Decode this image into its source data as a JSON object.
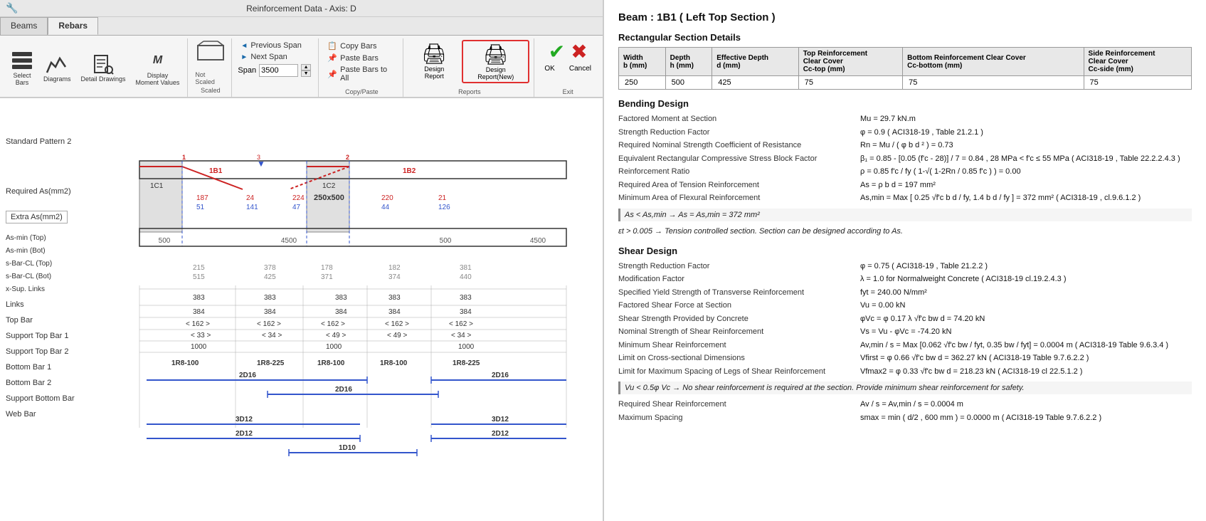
{
  "window": {
    "title": "Reinforcement Data - Axis: D"
  },
  "tabs": [
    {
      "id": "beams",
      "label": "Beams",
      "active": false
    },
    {
      "id": "rebars",
      "label": "Rebars",
      "active": true
    }
  ],
  "ribbon": {
    "select_bars_label": "Select\nBars",
    "diagrams_label": "Diagrams",
    "detail_drawings_label": "Detail\nDrawings",
    "display_moment_label": "Display\nMoment Values",
    "display_moment_abbr": "M",
    "scaled_label": "Scaled",
    "not_scaled_label": "Not Scaled",
    "previous_span_label": "Previous Span",
    "next_span_label": "Next Span",
    "span_label": "Span",
    "span_value": "3500",
    "copy_bars_label": "Copy Bars",
    "paste_bars_label": "Paste Bars",
    "paste_bars_all_label": "Paste Bars to All",
    "copy_paste_group_label": "Copy/Paste",
    "design_report_label": "Design\nReport",
    "design_report_new_label": "Design\nReport(New)",
    "reports_group_label": "Reports",
    "ok_label": "OK",
    "cancel_label": "Cancel",
    "exit_group_label": "Exit"
  },
  "diagram": {
    "standard_pattern_label": "Standard Pattern 2",
    "required_as_label": "Required As(mm2)",
    "extra_as_label": "Extra As(mm2)",
    "asmin_top_label": "As-min (Top)",
    "asmin_bot_label": "As-min (Bot)",
    "sbar_cl_top_label": "s-Bar-CL (Top)",
    "sbar_cl_bot_label": "s-Bar-CL (Bot)",
    "xsup_links_label": "x-Sup. Links",
    "links_label": "Links",
    "top_bar_label": "Top Bar",
    "support_top_bar1_label": "Support Top Bar 1",
    "support_top_bar2_label": "Support Top Bar 2",
    "bottom_bar1_label": "Bottom Bar 1",
    "bottom_bar2_label": "Bottom Bar 2",
    "support_bottom_bar_label": "Support Bottom Bar",
    "web_bar_label": "Web Bar",
    "beam_label": "250x500",
    "span1": "4500",
    "span2": "500",
    "span3": "4500",
    "bar_1b1": "1B1",
    "bar_1b2": "1B2",
    "bar_1c1": "1C1",
    "bar_1c2": "1C2",
    "links_val1": "1R8-100",
    "links_val2": "1R8-225",
    "links_val3": "1R8-100",
    "links_val4": "1R8-100",
    "links_val5": "1R8-225",
    "top_bar_val": "2D16",
    "support_top_bar1_val": "2D16",
    "bottom_bar1_val": "3D12",
    "bottom_bar2_val": "2D12",
    "support_bottom_bar_val": "1D10"
  },
  "report": {
    "beam_title": "Beam : 1B1 ( Left Top Section )",
    "rect_section_title": "Rectangular Section Details",
    "table_headers": [
      "Width\nb (mm)",
      "Depth\nh (mm)",
      "Effective Depth\nd (mm)",
      "Top Reinforcement\nClear Cover\nCc-top (mm)",
      "Bottom Reinforcement Clear Cover\nCc-bottom (mm)",
      "Side Reinforcement\nClear Cover\nCc-side (mm)"
    ],
    "table_values": [
      "250",
      "500",
      "425",
      "75",
      "75",
      "75"
    ],
    "bending_title": "Bending Design",
    "bending_rows": [
      {
        "label": "Factored Moment at Section",
        "value": "Mu = 29.7 kN.m"
      },
      {
        "label": "Strength Reduction Factor",
        "value": "φ = 0.9 ( ACI318-19 , Table 21.2.1 )"
      },
      {
        "label": "Required Nominal Strength Coefficient of Resistance",
        "value": "Rn = Mu / ( φ b d ² ) = 0.73"
      },
      {
        "label": "Equivalent Rectangular Compressive Stress Block Factor",
        "value": "β₁ = 0.85 - [0.05 (f'c - 28)] / 7 = 0.84 , 28 MPa < f'c ≤ 55 MPa ( ACI318-19 , Table 22.2.2.4.3 )"
      },
      {
        "label": "Reinforcement Ratio",
        "value": "ρ = 0.85 f'c / fy ( 1-√( 1-2Rn / 0.85 f'c ) ) = 0.00"
      },
      {
        "label": "Required Area of Tension Reinforcement",
        "value": "As = ρ b d = 197 mm²"
      },
      {
        "label": "Minimum Area of Flexural Reinforcement",
        "value": "As,min = Max [ 0.25 √f'c b d / fy, 1.4 b d / fy ] = 372 mm² ( ACI318-19 , cl.9.6.1.2 )"
      }
    ],
    "formula1": "As < As,min → As = As,min = 372 mm²",
    "formula2": "εt > 0.005 → Tension controlled section. Section can be designed according to As.",
    "shear_title": "Shear Design",
    "shear_rows": [
      {
        "label": "Strength Reduction Factor",
        "value": "φ = 0.75 ( ACI318-19 , Table 21.2.2 )"
      },
      {
        "label": "Modification Factor",
        "value": "λ = 1.0 for Normalweight Concrete ( ACI318-19 cl.19.2.4.3 )"
      },
      {
        "label": "Specified Yield Strength of Transverse Reinforcement",
        "value": "fyt = 240.00 N/mm²"
      },
      {
        "label": "Factored Shear Force at Section",
        "value": "Vu = 0.00 kN"
      },
      {
        "label": "Shear Strength Provided by Concrete",
        "value": "φVc = φ 0.17 λ √f'c bw d = 74.20 kN"
      },
      {
        "label": "Nominal Strength of Shear Reinforcement",
        "value": "Vs = Vu - φVc = -74.20 kN"
      },
      {
        "label": "Minimum Shear Reinforcement",
        "value": "Av,min / s = Max [0.062 √f'c bw / fyt, 0.35 bw / fyt] = 0.0004 m ( ACI318-19 Table 9.6.3.4 )"
      },
      {
        "label": "Limit on Cross-sectional Dimensions",
        "value": "Vfirst = φ 0.66 √f'c bw d = 362.27 kN ( ACI318-19 Table 9.7.6.2.2 )"
      },
      {
        "label": "Limit for Maximum Spacing of Legs of Shear Reinforcement",
        "value": "Vfmax2 = φ 0.33 √f'c bw d = 218.23 kN ( ACI318-19 cl 22.5.1.2 )"
      }
    ],
    "shear_note": "Vu < 0.5φ Vc → No shear reinforcement is required at the section. Provide minimum shear reinforcement for safety.",
    "shear_rows2": [
      {
        "label": "Required Shear Reinforcement",
        "value": "Av / s = Av,min / s = 0.0004 m"
      },
      {
        "label": "Maximum Spacing",
        "value": "smax = min ( d/2 , 600 mm ) = 0.0000 m ( ACI318-19 Table 9.7.6.2.2 )"
      }
    ]
  }
}
